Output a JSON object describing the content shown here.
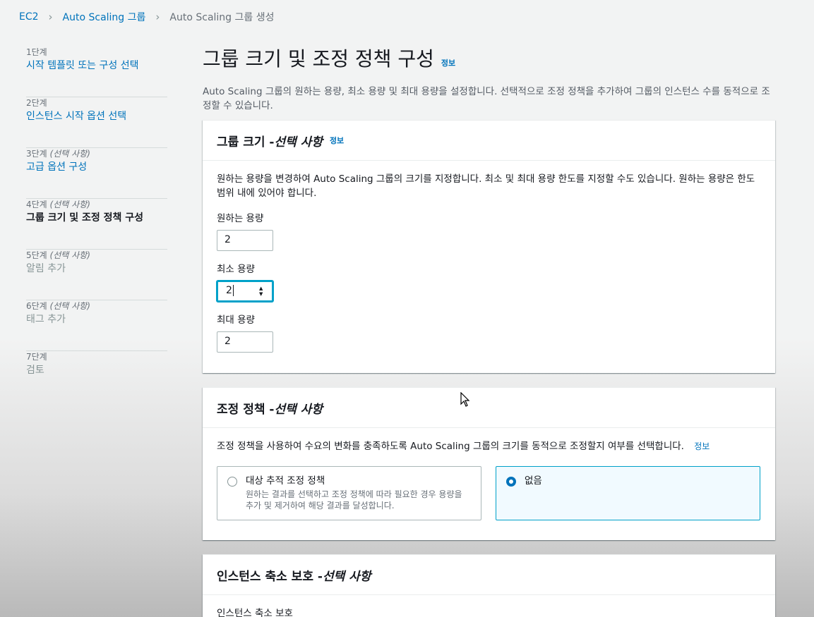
{
  "breadcrumb": {
    "items": [
      "EC2",
      "Auto Scaling 그룹"
    ],
    "current": "Auto Scaling 그룹 생성"
  },
  "steps": [
    {
      "num": "1단계",
      "optional": "",
      "title": "시작 템플릿 또는 구성 선택",
      "state": "link"
    },
    {
      "num": "2단계",
      "optional": "",
      "title": "인스턴스 시작 옵션 선택",
      "state": "link"
    },
    {
      "num": "3단계",
      "optional": "(선택 사항)",
      "title": "고급 옵션 구성",
      "state": "link"
    },
    {
      "num": "4단계",
      "optional": "(선택 사항)",
      "title": "그룹 크기 및 조정 정책 구성",
      "state": "active"
    },
    {
      "num": "5단계",
      "optional": "(선택 사항)",
      "title": "알림 추가",
      "state": "disabled"
    },
    {
      "num": "6단계",
      "optional": "(선택 사항)",
      "title": "태그 추가",
      "state": "disabled"
    },
    {
      "num": "7단계",
      "optional": "",
      "title": "검토",
      "state": "disabled"
    }
  ],
  "page": {
    "title": "그룹 크기 및 조정 정책 구성",
    "info": "정보",
    "description": "Auto Scaling 그룹의 원하는 용량, 최소 용량 및 최대 용량을 설정합니다. 선택적으로 조정 정책을 추가하여 그룹의 인스턴스 수를 동적으로 조정할 수 있습니다."
  },
  "group_size": {
    "title": "그룹 크기 - ",
    "title_optional": "선택 사항",
    "info": "정보",
    "description": "원하는 용량을 변경하여 Auto Scaling 그룹의 크기를 지정합니다. 최소 및 최대 용량 한도를 지정할 수도 있습니다. 원하는 용량은 한도 범위 내에 있어야 합니다.",
    "desired_label": "원하는 용량",
    "desired_value": "2",
    "min_label": "최소 용량",
    "min_value": "2",
    "max_label": "최대 용량",
    "max_value": "2"
  },
  "scaling_policy": {
    "title": "조정 정책 - ",
    "title_optional": "선택 사항",
    "description": "조정 정책을 사용하여 수요의 변화를 충족하도록 Auto Scaling 그룹의 크기를 동적으로 조정할지 여부를 선택합니다.",
    "info": "정보",
    "option_target": {
      "title": "대상 추적 조정 정책",
      "subtitle": "원하는 결과를 선택하고 조정 정책에 따라 필요한 경우 용량을 추가 및 제거하여 해당 결과를 달성합니다."
    },
    "option_none": {
      "title": "없음"
    },
    "selected": "none"
  },
  "scale_in_protection": {
    "title": "인스턴스 축소 보호 - ",
    "title_optional": "선택 사항",
    "field_label": "인스턴스 축소 보호"
  },
  "colors": {
    "link": "#0073bb",
    "focus": "#00a1c9"
  }
}
